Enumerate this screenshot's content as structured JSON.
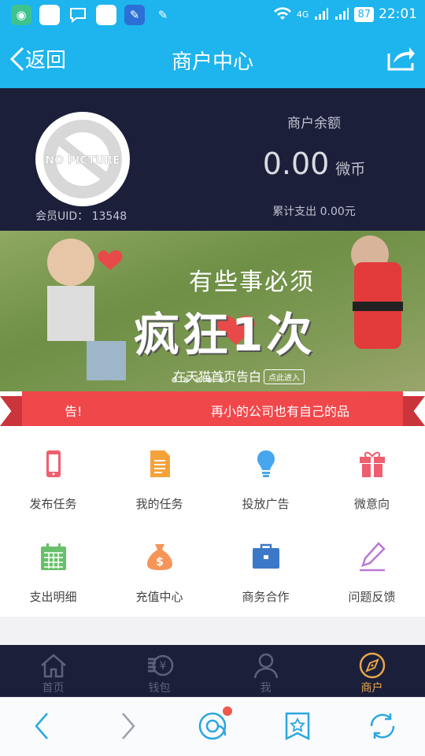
{
  "status_bar": {
    "battery": "87",
    "network": "4G",
    "time": "22:01"
  },
  "nav": {
    "back_label": "返回",
    "title": "商户中心"
  },
  "profile": {
    "avatar_text": "NO PICTURE",
    "uid_label": "会员UID：",
    "uid_value": "13548"
  },
  "balance": {
    "label": "商户余额",
    "amount": "0.00",
    "unit": "微币",
    "spent": "累计支出 0.00元"
  },
  "banner": {
    "tagline": "有些事必须",
    "headline": "疯狂1次",
    "subline": "在天猫首页告白",
    "button": "点此进入"
  },
  "notice": {
    "left_text": "告!",
    "right_text": "再小的公司也有自己的品"
  },
  "menu": [
    {
      "label": "发布任务",
      "icon": "phone-icon",
      "color": "#ef5e6e"
    },
    {
      "label": "我的任务",
      "icon": "document-icon",
      "color": "#f5a23a"
    },
    {
      "label": "投放广告",
      "icon": "lightbulb-icon",
      "color": "#46a6ee"
    },
    {
      "label": "微意向",
      "icon": "gift-icon",
      "color": "#ef5e6e"
    },
    {
      "label": "支出明细",
      "icon": "calendar-icon",
      "color": "#68c06a"
    },
    {
      "label": "充值中心",
      "icon": "money-bag-icon",
      "color": "#f5955a"
    },
    {
      "label": "商务合作",
      "icon": "briefcase-icon",
      "color": "#3c78c8"
    },
    {
      "label": "问题反馈",
      "icon": "pen-icon",
      "color": "#b979d6"
    }
  ],
  "tabs": [
    {
      "label": "首页",
      "icon": "home-icon"
    },
    {
      "label": "钱包",
      "icon": "wallet-icon"
    },
    {
      "label": "我",
      "icon": "user-icon"
    },
    {
      "label": "商户",
      "icon": "compass-icon",
      "active": true
    }
  ],
  "colors": {
    "primary": "#1eb4ee",
    "dark": "#1b1f3a",
    "accent": "#e8a64a",
    "notice_red": "#f0474b"
  }
}
